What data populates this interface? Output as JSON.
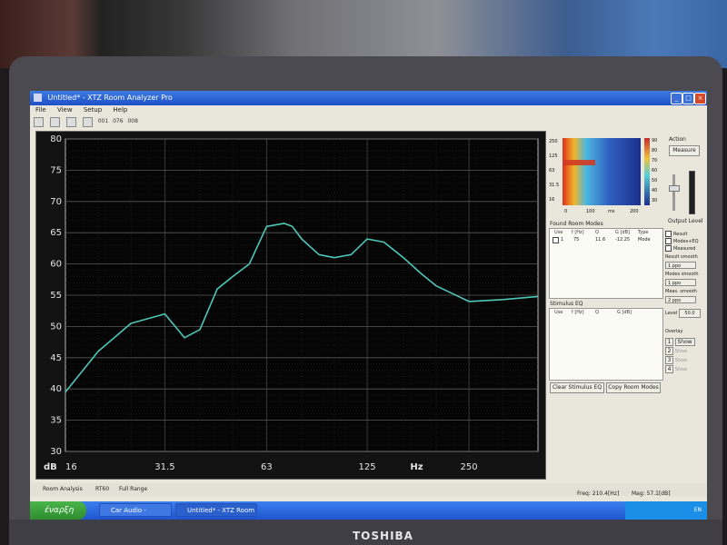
{
  "window": {
    "title": "Untitled* - XTZ Room Analyzer Pro"
  },
  "menu": [
    "File",
    "View",
    "Setup",
    "Help"
  ],
  "toolbar": {
    "labels": [
      "001",
      "076",
      "008"
    ]
  },
  "graph": {
    "y_unit": "dB",
    "x_unit": "Hz",
    "y_ticks": [
      "80",
      "75",
      "70",
      "65",
      "60",
      "55",
      "50",
      "45",
      "40",
      "35",
      "30"
    ],
    "x_ticks": [
      "16",
      "31.5",
      "63",
      "125",
      "250"
    ],
    "trace_color": "#4fc7b8"
  },
  "chart_data": {
    "type": "line",
    "xlabel": "Hz",
    "ylabel": "dB",
    "x_scale": "log",
    "xlim": [
      16,
      400
    ],
    "ylim": [
      30,
      80
    ],
    "grid": true,
    "series": [
      {
        "x": [
          16,
          20,
          25,
          31.5,
          36,
          40,
          45,
          50,
          56,
          63,
          71,
          75,
          80,
          90,
          100,
          112,
          125,
          140,
          160,
          180,
          200,
          250,
          315,
          400
        ],
        "y": [
          39.5,
          46,
          50.5,
          52,
          48.2,
          49.5,
          56,
          58,
          60,
          66,
          66.5,
          66,
          64,
          61.5,
          61,
          61.5,
          64,
          63.5,
          61,
          58.5,
          56.5,
          54,
          54.3,
          54.8
        ]
      }
    ]
  },
  "waterfall": {
    "y_ticks": [
      "250",
      "125",
      "63",
      "31.5",
      "16"
    ],
    "x_ticks": [
      "0",
      "100",
      "ms",
      "200"
    ],
    "scale_ticks": [
      "90",
      "80",
      "70",
      "60",
      "50",
      "40",
      "30"
    ]
  },
  "room_modes": {
    "label": "Found Room Modes",
    "headers": [
      "Use",
      "f [Hz]",
      "Q",
      "G [dB]",
      "Type"
    ],
    "rows": [
      {
        "index": "1",
        "f": "75",
        "q": "11.6",
        "g": "-12.25",
        "type": "Mode"
      }
    ]
  },
  "stimulus_eq": {
    "label": "Stimulus EQ",
    "headers": [
      "Use",
      "f [Hz]",
      "Q",
      "G [dB]"
    ]
  },
  "buttons": {
    "clear": "Clear Stimulus EQ",
    "copy": "Copy Room Modes",
    "measure": "Measure"
  },
  "action": {
    "label": "Action",
    "output_level": "Output Level"
  },
  "options": {
    "checkboxes": [
      "Result",
      "Modes+EQ",
      "Measured"
    ],
    "result_smooth_label": "Result smooth",
    "result_smooth": "1 ppo",
    "modes_smooth_label": "Modes smooth",
    "modes_smooth": "1 ppo",
    "meas_smooth_label": "Meas. smooth",
    "meas_smooth": "2 ppo",
    "level_label": "Level",
    "level_value": "50.0",
    "overlay_label": "Overlay",
    "overlays": [
      {
        "n": "1",
        "label": "Show"
      },
      {
        "n": "2",
        "label": "Show"
      },
      {
        "n": "3",
        "label": "Show"
      },
      {
        "n": "4",
        "label": "Show"
      }
    ]
  },
  "tabs": [
    "Room Analysis",
    "RT60",
    "Full Range"
  ],
  "status": {
    "freq": "Freq: 210.4[Hz]",
    "mag": "Mag: 57.1[dB]"
  },
  "taskbar": {
    "start": "έναρξη",
    "tasks": [
      "Car Audio - Crossove...",
      "Untitled* - XTZ Room ..."
    ],
    "tray": "EN"
  },
  "laptop": {
    "brand": "TOSHIBA"
  }
}
